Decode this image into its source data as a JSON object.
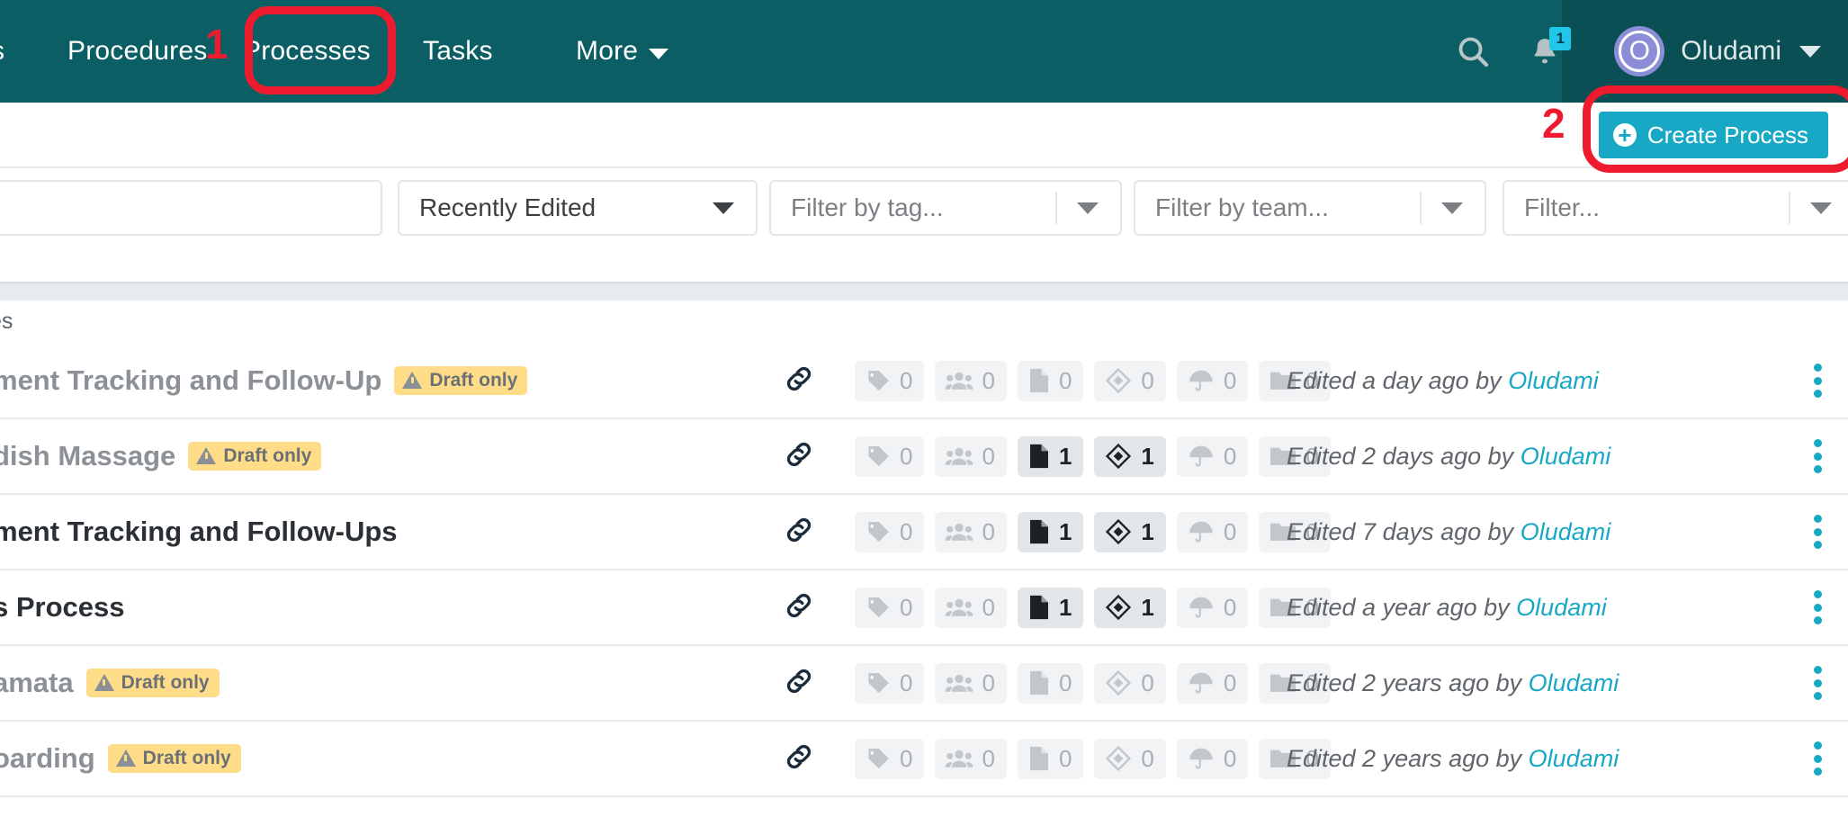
{
  "nav": {
    "items": [
      {
        "label": "s",
        "partial": true,
        "active": false
      },
      {
        "label": "Procedures",
        "active": false
      },
      {
        "label": "Processes",
        "active": true
      },
      {
        "label": "Tasks",
        "active": false
      },
      {
        "label": "More",
        "active": false,
        "has_caret": true
      }
    ],
    "search_icon": "search-icon",
    "notifications_icon": "bell-icon",
    "notification_count": "1",
    "user": {
      "initial": "O",
      "name": "Oludami"
    }
  },
  "actionbar": {
    "create_label": "Create Process",
    "create_icon": "plus-circle-icon"
  },
  "filters": {
    "search_value": "",
    "sort": {
      "value": "Recently Edited"
    },
    "tag": {
      "placeholder": "Filter by tag..."
    },
    "team": {
      "placeholder": "Filter by team..."
    },
    "other": {
      "placeholder": "Filter..."
    }
  },
  "table": {
    "subheader": "es",
    "rows": [
      {
        "title": "ment Tracking and Follow-Up",
        "draft": true,
        "draft_label": "Draft only",
        "chips": [
          {
            "icon": "tag-icon",
            "count": "0",
            "active": false
          },
          {
            "icon": "users-icon",
            "count": "0",
            "active": false
          },
          {
            "icon": "document-icon",
            "count": "0",
            "active": false
          },
          {
            "icon": "diamond-icon",
            "count": "0",
            "active": false
          },
          {
            "icon": "umbrella-icon",
            "count": "0",
            "active": false
          },
          {
            "icon": "folder-icon",
            "count": "0",
            "active": false
          }
        ],
        "edited_prefix": "Edited a day ago by ",
        "edited_by": "Oludami"
      },
      {
        "title": "dish Massage",
        "draft": true,
        "draft_label": "Draft only",
        "chips": [
          {
            "icon": "tag-icon",
            "count": "0",
            "active": false
          },
          {
            "icon": "users-icon",
            "count": "0",
            "active": false
          },
          {
            "icon": "document-icon",
            "count": "1",
            "active": true
          },
          {
            "icon": "diamond-icon",
            "count": "1",
            "active": true
          },
          {
            "icon": "umbrella-icon",
            "count": "0",
            "active": false
          },
          {
            "icon": "folder-icon",
            "count": "0",
            "active": false
          }
        ],
        "edited_prefix": "Edited 2 days ago by ",
        "edited_by": "Oludami"
      },
      {
        "title": "ment Tracking and Follow-Ups",
        "draft": false,
        "draft_label": "",
        "chips": [
          {
            "icon": "tag-icon",
            "count": "0",
            "active": false
          },
          {
            "icon": "users-icon",
            "count": "0",
            "active": false
          },
          {
            "icon": "document-icon",
            "count": "1",
            "active": true
          },
          {
            "icon": "diamond-icon",
            "count": "1",
            "active": true
          },
          {
            "icon": "umbrella-icon",
            "count": "0",
            "active": false
          },
          {
            "icon": "folder-icon",
            "count": "0",
            "active": false
          }
        ],
        "edited_prefix": "Edited 7 days ago by ",
        "edited_by": "Oludami"
      },
      {
        "title": "s Process",
        "draft": false,
        "draft_label": "",
        "chips": [
          {
            "icon": "tag-icon",
            "count": "0",
            "active": false
          },
          {
            "icon": "users-icon",
            "count": "0",
            "active": false
          },
          {
            "icon": "document-icon",
            "count": "1",
            "active": true
          },
          {
            "icon": "diamond-icon",
            "count": "1",
            "active": true
          },
          {
            "icon": "umbrella-icon",
            "count": "0",
            "active": false
          },
          {
            "icon": "folder-icon",
            "count": "0",
            "active": false
          }
        ],
        "edited_prefix": "Edited a year ago by ",
        "edited_by": "Oludami"
      },
      {
        "title": "amata",
        "draft": true,
        "draft_label": "Draft only",
        "chips": [
          {
            "icon": "tag-icon",
            "count": "0",
            "active": false
          },
          {
            "icon": "users-icon",
            "count": "0",
            "active": false
          },
          {
            "icon": "document-icon",
            "count": "0",
            "active": false
          },
          {
            "icon": "diamond-icon",
            "count": "0",
            "active": false
          },
          {
            "icon": "umbrella-icon",
            "count": "0",
            "active": false
          },
          {
            "icon": "folder-icon",
            "count": "0",
            "active": false
          }
        ],
        "edited_prefix": "Edited 2 years ago by ",
        "edited_by": "Oludami"
      },
      {
        "title": "oarding",
        "draft": true,
        "draft_label": "Draft only",
        "chips": [
          {
            "icon": "tag-icon",
            "count": "0",
            "active": false
          },
          {
            "icon": "users-icon",
            "count": "0",
            "active": false
          },
          {
            "icon": "document-icon",
            "count": "0",
            "active": false
          },
          {
            "icon": "diamond-icon",
            "count": "0",
            "active": false
          },
          {
            "icon": "umbrella-icon",
            "count": "0",
            "active": false
          },
          {
            "icon": "folder-icon",
            "count": "0",
            "active": false
          }
        ],
        "edited_prefix": "Edited 2 years ago by ",
        "edited_by": "Oludami"
      }
    ]
  },
  "annotations": [
    {
      "number": "1",
      "target": "processes-tab"
    },
    {
      "number": "2",
      "target": "create-process-button"
    }
  ],
  "colors": {
    "navbar": "#0b5e63",
    "navbar_dark": "#0a4f54",
    "accent_cyan": "#17a8c6",
    "underline": "#21c7e8",
    "annotation_red": "#ee1b2e",
    "draft_badge": "#ffdd88",
    "avatar": "#8b8ed6"
  }
}
